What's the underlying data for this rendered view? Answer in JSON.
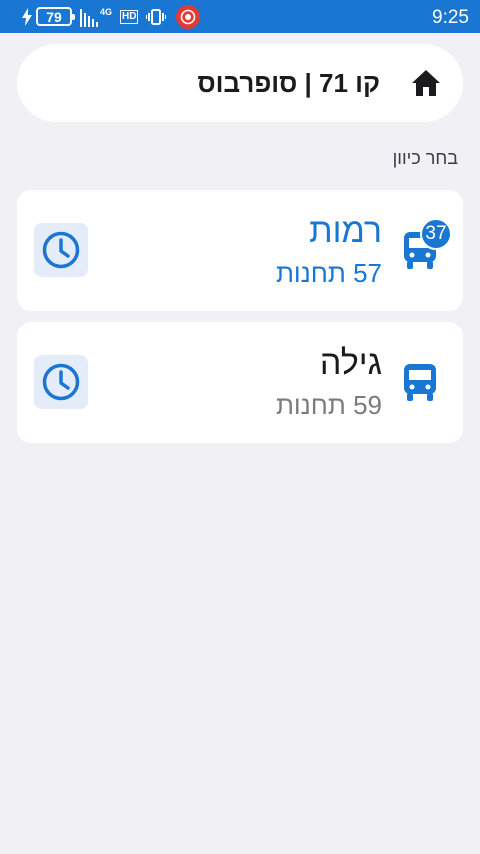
{
  "status_bar": {
    "battery_level": "79",
    "network_type": "4G",
    "hd_label": "HD",
    "time": "9:25"
  },
  "header": {
    "title": "קו 71 | סופרבוס",
    "home_icon": "home-icon"
  },
  "section_label": "בחר כיוון",
  "directions": [
    {
      "name": "רמות",
      "stops": "57 תחנות",
      "badge": "37",
      "highlighted": true
    },
    {
      "name": "גילה",
      "stops": "59 תחנות",
      "highlighted": false
    }
  ],
  "colors": {
    "primary": "#1976d2",
    "background": "#f1f0f5",
    "card": "#ffffff",
    "schedule_bg": "#e3ecf8"
  }
}
